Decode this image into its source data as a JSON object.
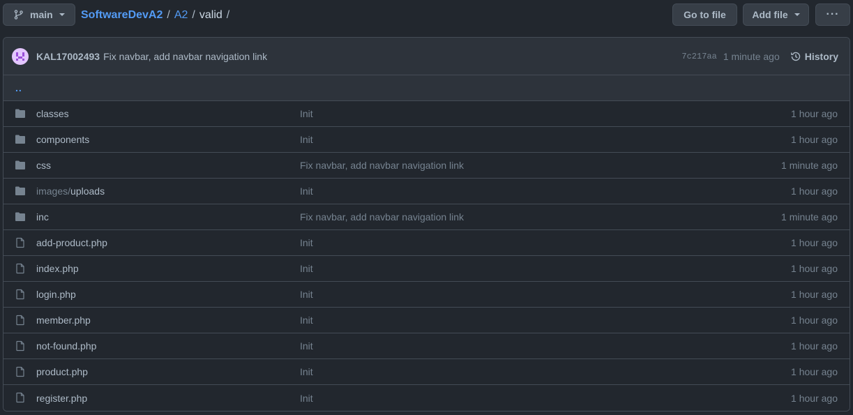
{
  "branch": {
    "name": "main"
  },
  "breadcrumb": {
    "repo": "SoftwareDevA2",
    "sep": "/",
    "folder": "A2",
    "current": "valid"
  },
  "toolbar": {
    "goto_label": "Go to file",
    "add_label": "Add file",
    "more_label": "···"
  },
  "commit": {
    "author": "KAL17002493",
    "message": "Fix navbar, add navbar navigation link",
    "sha": "7c217aa",
    "time": "1 minute ago",
    "history_label": "History"
  },
  "parent_dir": "..",
  "files": [
    {
      "type": "dir",
      "name": "classes",
      "name_prefix": "",
      "commit": "Init",
      "time": "1 hour ago",
      "icon": "folder-icon"
    },
    {
      "type": "dir",
      "name": "components",
      "name_prefix": "",
      "commit": "Init",
      "time": "1 hour ago",
      "icon": "folder-icon"
    },
    {
      "type": "dir",
      "name": "css",
      "name_prefix": "",
      "commit": "Fix navbar, add navbar navigation link",
      "time": "1 minute ago",
      "icon": "folder-icon"
    },
    {
      "type": "dir",
      "name": "uploads",
      "name_prefix": "images/",
      "commit": "Init",
      "time": "1 hour ago",
      "icon": "folder-icon"
    },
    {
      "type": "dir",
      "name": "inc",
      "name_prefix": "",
      "commit": "Fix navbar, add navbar navigation link",
      "time": "1 minute ago",
      "icon": "folder-icon"
    },
    {
      "type": "file",
      "name": "add-product.php",
      "name_prefix": "",
      "commit": "Init",
      "time": "1 hour ago",
      "icon": "file-icon"
    },
    {
      "type": "file",
      "name": "index.php",
      "name_prefix": "",
      "commit": "Init",
      "time": "1 hour ago",
      "icon": "file-icon"
    },
    {
      "type": "file",
      "name": "login.php",
      "name_prefix": "",
      "commit": "Init",
      "time": "1 hour ago",
      "icon": "file-icon"
    },
    {
      "type": "file",
      "name": "member.php",
      "name_prefix": "",
      "commit": "Init",
      "time": "1 hour ago",
      "icon": "file-icon"
    },
    {
      "type": "file",
      "name": "not-found.php",
      "name_prefix": "",
      "commit": "Init",
      "time": "1 hour ago",
      "icon": "file-icon"
    },
    {
      "type": "file",
      "name": "product.php",
      "name_prefix": "",
      "commit": "Init",
      "time": "1 hour ago",
      "icon": "file-icon"
    },
    {
      "type": "file",
      "name": "register.php",
      "name_prefix": "",
      "commit": "Init",
      "time": "1 hour ago",
      "icon": "file-icon"
    }
  ],
  "colors": {
    "background": "#22272e",
    "accent": "#539bf5",
    "border": "#444c56",
    "folder": "#768390"
  }
}
